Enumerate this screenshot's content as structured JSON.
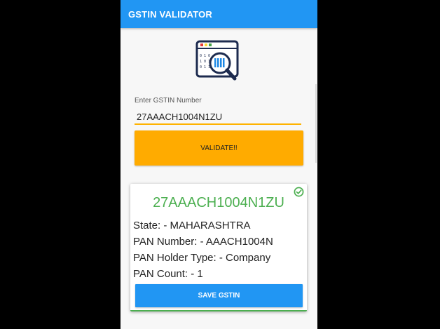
{
  "app_bar": {
    "title": "GSTIN VALIDATOR"
  },
  "logo": {
    "icon": "gst-search-icon"
  },
  "form": {
    "label": "Enter GSTIN Number",
    "gstin_value": "27AAACH1004N1ZU",
    "validate_label": "VALIDATE!!"
  },
  "result": {
    "gstin": "27AAACH1004N1ZU",
    "state": "State: - MAHARASHTRA",
    "pan_number": "PAN Number: - AAACH1004N",
    "pan_holder_type": "PAN Holder Type: - Company",
    "pan_count": "PAN Count: - 1",
    "save_label": "SAVE GSTIN",
    "status_icon": "check-circle-icon"
  },
  "colors": {
    "primary": "#2196f3",
    "accent": "#ffab00",
    "success": "#4caf50",
    "background": "#f7f7f7"
  }
}
